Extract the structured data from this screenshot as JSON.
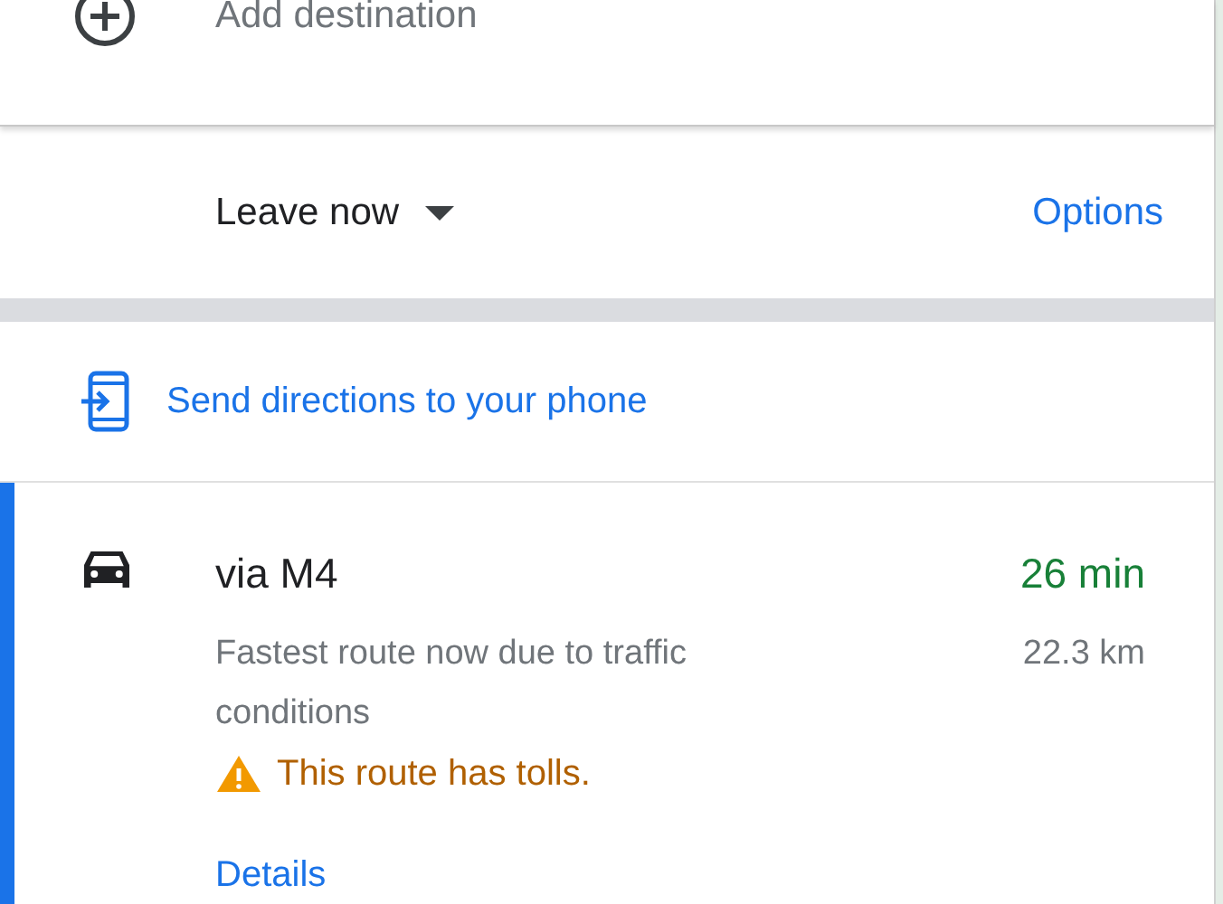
{
  "add_destination": {
    "label": "Add destination"
  },
  "departure": {
    "label": "Leave now",
    "options": "Options"
  },
  "send_to_phone": {
    "label": "Send directions to your phone"
  },
  "routes": [
    {
      "selected": true,
      "title": "via M4",
      "duration": "26 min",
      "distance": "22.3 km",
      "description": "Fastest route now due to traffic conditions",
      "warning": "This route has tolls.",
      "details": "Details"
    }
  ]
}
